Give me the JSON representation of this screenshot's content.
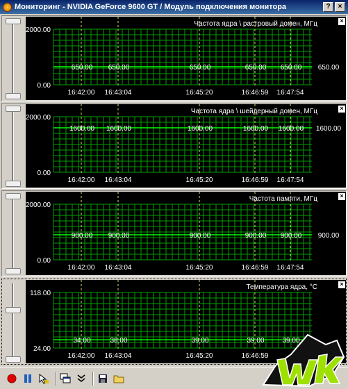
{
  "window": {
    "title": "Мониторинг - NVIDIA GeForce 9600 GT / Модуль подключения монитора",
    "help_label": "?",
    "close_label": "×"
  },
  "graph_close_label": "×",
  "panels": [
    {
      "title": "Частота ядра \\ растровый домен, МГц",
      "y_max": "2000.00",
      "y_min": "0.00",
      "ymax": 2000,
      "ymin": 0,
      "value": 650,
      "readings": [
        "650.00",
        "650.00",
        "650.00",
        "650.00",
        "650.00",
        "650.00"
      ],
      "times": [
        "16:42:00",
        "16:43:04",
        "16:45:20",
        "16:46:59",
        "16:47:54"
      ]
    },
    {
      "title": "Частота ядра \\ шейдерный домен, МГц",
      "y_max": "2000.00",
      "y_min": "0.00",
      "ymax": 2000,
      "ymin": 0,
      "value": 1600,
      "readings": [
        "1600.00",
        "1600.00",
        "1600.00",
        "1600.00",
        "1600.00",
        "1600.00"
      ],
      "times": [
        "16:42:00",
        "16:43:04",
        "16:45:20",
        "16:46:59",
        "16:47:54"
      ]
    },
    {
      "title": "Частота памяти, МГц",
      "y_max": "2000.00",
      "y_min": "0.00",
      "ymax": 2000,
      "ymin": 0,
      "value": 900,
      "readings": [
        "900.00",
        "900.00",
        "900.00",
        "900.00",
        "900.00",
        "900.00"
      ],
      "times": [
        "16:42:00",
        "16:43:04",
        "16:45:20",
        "16:46:59",
        "16:47:54"
      ]
    },
    {
      "title": "Температура ядра, °C",
      "y_max": "118.00",
      "y_min": "24.00",
      "ymax": 118,
      "ymin": 24,
      "value": 38,
      "readings": [
        "34.00",
        "38.00",
        "39.00",
        "39.00",
        "39.00"
      ],
      "times": [
        "16:42:00",
        "16:43:04",
        "16:45:20",
        "16:46:59"
      ]
    }
  ],
  "toolbar": {
    "icons": [
      "record-icon",
      "pause-icon",
      "cursor-icon",
      "windows-icon",
      "collapse-icon",
      "save-icon",
      "folder-icon"
    ]
  },
  "colors": {
    "grid": "#00a000",
    "line": "#00ff00",
    "marker": "#d8d870",
    "text": "#ffffff",
    "background": "#000000"
  }
}
